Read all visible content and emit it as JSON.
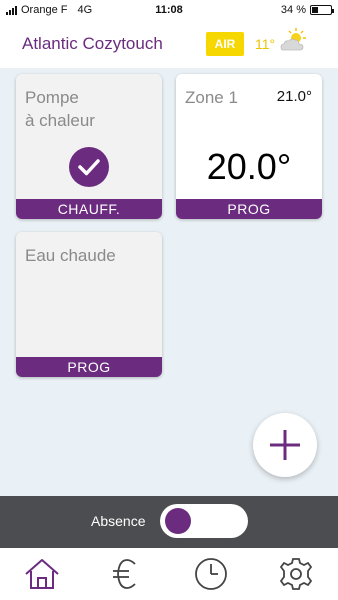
{
  "status_bar": {
    "carrier": "Orange F",
    "network": "4G",
    "time": "11:08",
    "battery": "34 %",
    "battery_level": 0.34
  },
  "header": {
    "title": "Atlantic Cozytouch",
    "air_badge": "AIR",
    "outside_temp": "11°",
    "weather_icon": "partly-cloudy-icon"
  },
  "cards": {
    "heat_pump": {
      "title_line1": "Pompe",
      "title_line2": "à chaleur",
      "status_icon": "check-icon",
      "footer": "CHAUFF."
    },
    "zone1": {
      "title": "Zone 1",
      "setpoint": "21.0°",
      "current_temp": "20.0°",
      "footer": "PROG"
    },
    "hot_water": {
      "title": "Eau chaude",
      "footer": "PROG"
    }
  },
  "add_button": {
    "icon": "plus-icon"
  },
  "absence": {
    "label": "Absence",
    "enabled": false
  },
  "nav": {
    "items": [
      {
        "icon": "home-icon",
        "active": true
      },
      {
        "icon": "euro-icon",
        "active": false
      },
      {
        "icon": "clock-icon",
        "active": false
      },
      {
        "icon": "gear-icon",
        "active": false
      }
    ]
  },
  "colors": {
    "primary": "#6b2c7f",
    "air_badge": "#f6d700",
    "absence_bar": "#4b4d50",
    "background": "#eaf1f6"
  }
}
